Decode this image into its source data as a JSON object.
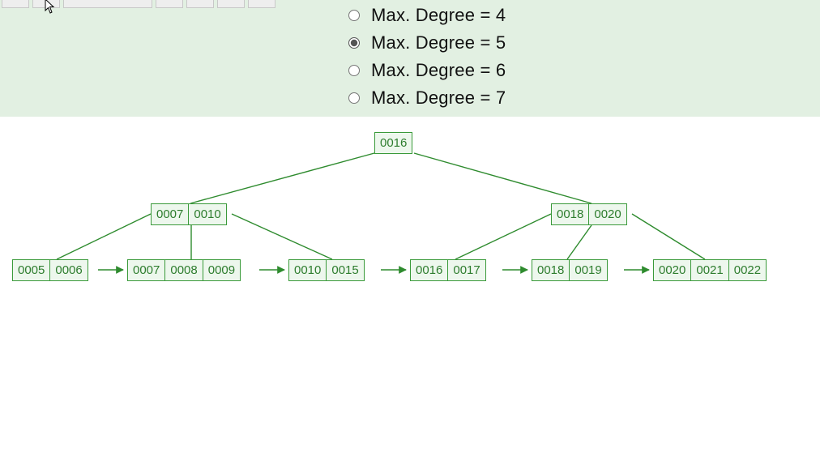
{
  "options": [
    {
      "label": "Max. Degree = 4",
      "selected": false
    },
    {
      "label": "Max. Degree = 5",
      "selected": true
    },
    {
      "label": "Max. Degree = 6",
      "selected": false
    },
    {
      "label": "Max. Degree = 7",
      "selected": false
    }
  ],
  "tree": {
    "root": {
      "keys": [
        "0016"
      ]
    },
    "mid": [
      {
        "keys": [
          "0007",
          "0010"
        ]
      },
      {
        "keys": [
          "0018",
          "0020"
        ]
      }
    ],
    "leaves": [
      {
        "keys": [
          "0005",
          "0006"
        ]
      },
      {
        "keys": [
          "0007",
          "0008",
          "0009"
        ]
      },
      {
        "keys": [
          "0010",
          "0015"
        ]
      },
      {
        "keys": [
          "0016",
          "0017"
        ]
      },
      {
        "keys": [
          "0018",
          "0019"
        ]
      },
      {
        "keys": [
          "0020",
          "0021",
          "0022"
        ]
      }
    ]
  },
  "colors": {
    "nodeBorder": "#3a9a3a",
    "nodeFill": "#edf7ed",
    "line": "#2e8b2e",
    "panel": "#e2f0e2"
  }
}
